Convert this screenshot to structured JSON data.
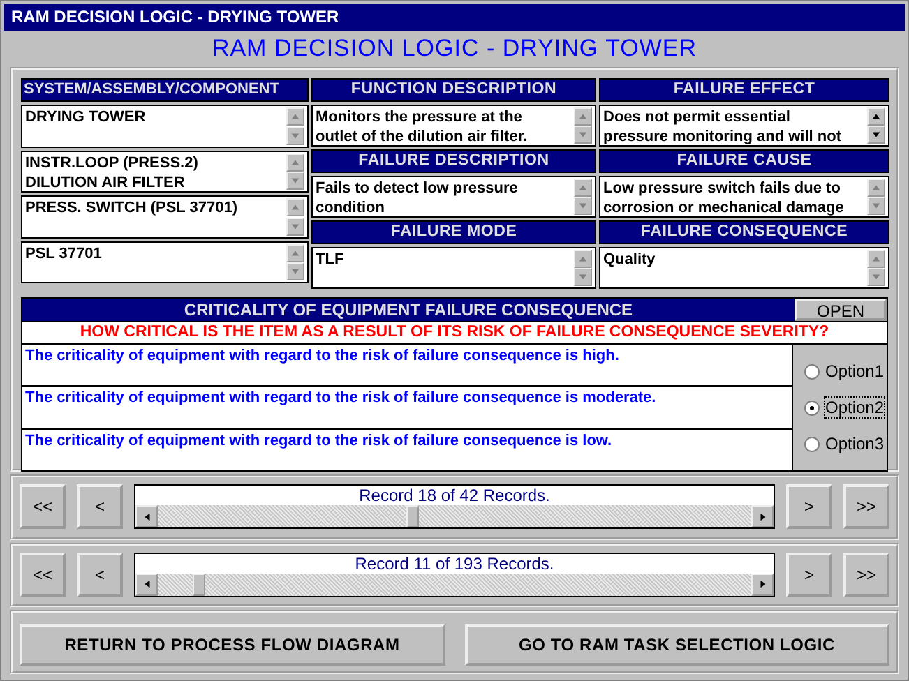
{
  "window": {
    "title": "RAM DECISION LOGIC - DRYING TOWER"
  },
  "heading": "RAM DECISION LOGIC - DRYING TOWER",
  "columns": [
    {
      "items": [
        {
          "kind": "header",
          "text": "SYSTEM/ASSEMBLY/COMPONENT"
        },
        {
          "kind": "box",
          "text": "DRYING TOWER"
        },
        {
          "kind": "box",
          "text": "INSTR.LOOP (PRESS.2)\nDILUTION AIR FILTER"
        },
        {
          "kind": "box",
          "text": "PRESS. SWITCH (PSL 37701)"
        },
        {
          "kind": "box",
          "text": "PSL 37701"
        }
      ]
    },
    {
      "items": [
        {
          "kind": "header",
          "text": "FUNCTION DESCRIPTION"
        },
        {
          "kind": "box",
          "text": "Monitors the pressure at the\noutlet of the dilution air filter."
        },
        {
          "kind": "header",
          "text": "FAILURE DESCRIPTION"
        },
        {
          "kind": "box",
          "text": "Fails to detect low pressure\ncondition"
        },
        {
          "kind": "header",
          "text": "FAILURE MODE"
        },
        {
          "kind": "box",
          "text": "TLF"
        }
      ]
    },
    {
      "items": [
        {
          "kind": "header",
          "text": "FAILURE EFFECT"
        },
        {
          "kind": "box",
          "text": "Does not permit essential\npressure monitoring and will not"
        },
        {
          "kind": "header",
          "text": "FAILURE CAUSE"
        },
        {
          "kind": "box",
          "text": "Low pressure switch fails due to\ncorrosion or mechanical damage"
        },
        {
          "kind": "header",
          "text": "FAILURE CONSEQUENCE"
        },
        {
          "kind": "box",
          "text": "Quality"
        }
      ]
    }
  ],
  "criticality": {
    "header": "CRITICALITY OF EQUIPMENT FAILURE CONSEQUENCE",
    "open_button": "OPEN",
    "question": "HOW CRITICAL IS THE ITEM AS A RESULT OF ITS RISK OF FAILURE CONSEQUENCE SEVERITY?",
    "options": [
      {
        "text": "The criticality of equipment with regard to the risk of failure consequence is high.",
        "label": "Option1",
        "selected": false
      },
      {
        "text": "The criticality of equipment with regard to the risk of failure consequence is moderate.",
        "label": "Option2",
        "selected": true
      },
      {
        "text": "The criticality of equipment with regard to the risk of failure consequence is low.",
        "label": "Option3",
        "selected": false
      }
    ]
  },
  "navigators": [
    {
      "first": "<<",
      "prev": "<",
      "record": "Record 18 of 42 Records.",
      "next": ">",
      "last": ">>"
    },
    {
      "first": "<<",
      "prev": "<",
      "record": "Record 11 of 193 Records.",
      "next": ">",
      "last": ">>"
    }
  ],
  "buttons": [
    "RETURN TO PROCESS FLOW DIAGRAM",
    "GO TO RAM TASK SELECTION LOGIC"
  ]
}
